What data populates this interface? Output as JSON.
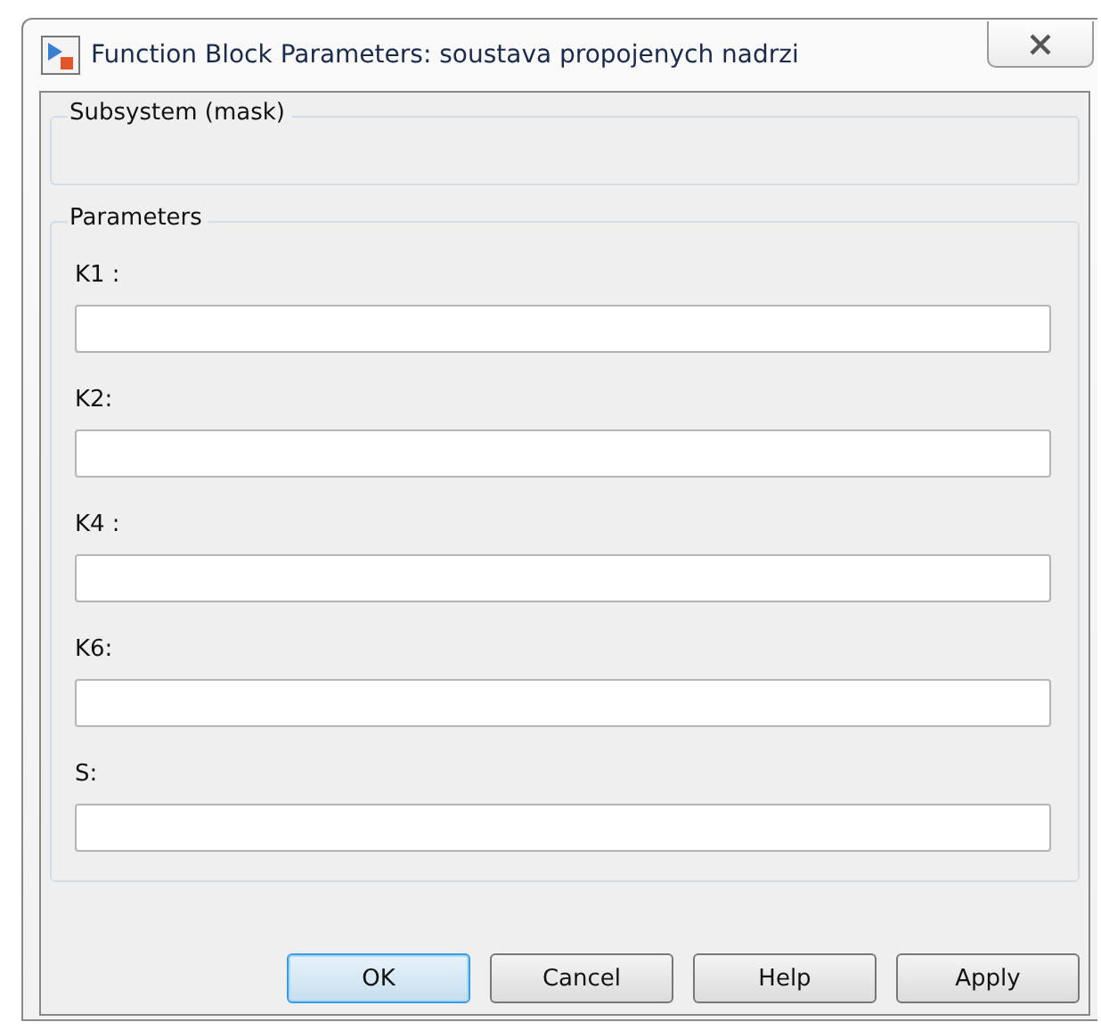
{
  "window": {
    "title": "Function Block Parameters: soustava propojenych nadrzi"
  },
  "description_group": {
    "title": "Subsystem (mask)"
  },
  "parameters_group": {
    "title": "Parameters",
    "fields": [
      {
        "label": "K1 :"
      },
      {
        "label": "K2:"
      },
      {
        "label": "K4 :"
      },
      {
        "label": "K6:"
      },
      {
        "label": "S:"
      }
    ]
  },
  "buttons": [
    {
      "label": "OK",
      "default": true
    },
    {
      "label": "Cancel",
      "default": false
    },
    {
      "label": "Help",
      "default": false
    },
    {
      "label": "Apply",
      "default": false
    }
  ]
}
